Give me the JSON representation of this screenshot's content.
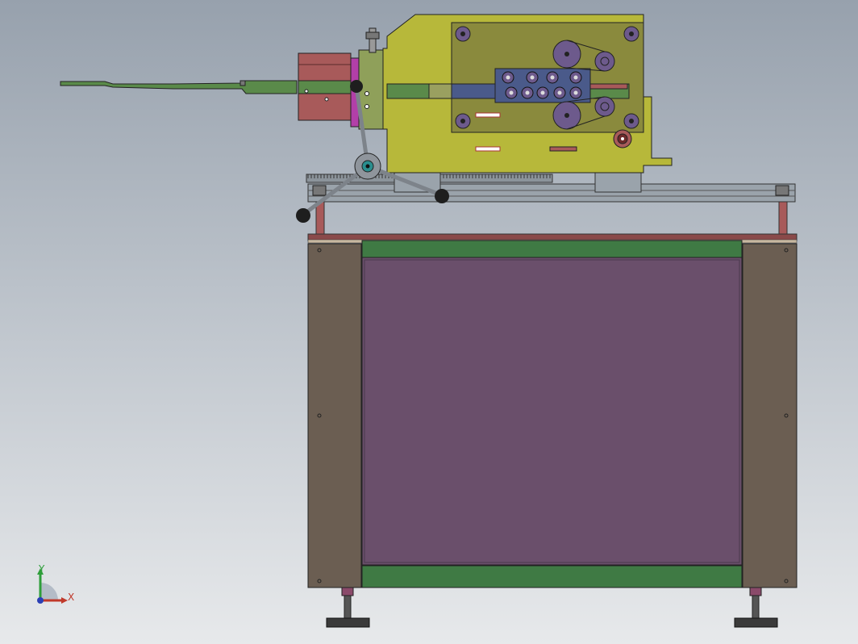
{
  "triad": {
    "x_label": "X",
    "y_label": "Y",
    "x_color": "#c0392b",
    "y_color": "#2e9e3a",
    "z_color": "#2b3fb5"
  },
  "colors": {
    "frame": "#6b5e52",
    "panel": "#6a4f6b",
    "green_rail": "#3f7a44",
    "head_body": "#b7b83a",
    "head_plate": "#8a8a3d",
    "table_top": "#8a4a4a",
    "rack": "#9aa3ab",
    "feeder_arm": "#5a8a4a",
    "roller": "#6d5a8c",
    "magenta_block": "#b23fa8",
    "teal_block": "#2a8e8e",
    "red_block": "#a85a5a",
    "handwheel": "#8f959c",
    "knob": "#1e1e1e"
  }
}
